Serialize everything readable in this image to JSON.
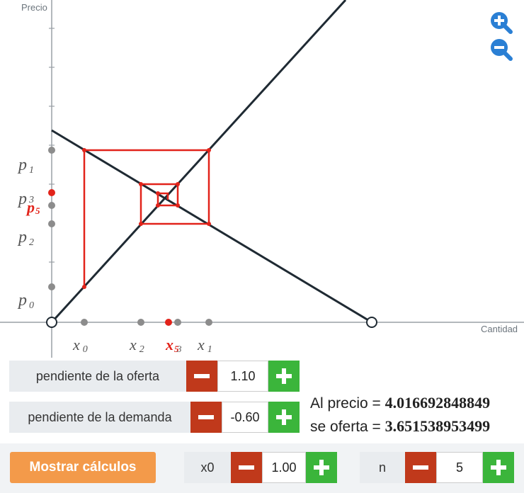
{
  "graph": {
    "y_axis_label": "Precio",
    "x_axis_label": "Cantidad",
    "price_labels": [
      {
        "base": "p",
        "sub": "1"
      },
      {
        "base": "p",
        "sub": "3"
      },
      {
        "base": "p",
        "sub": "5"
      },
      {
        "base": "p",
        "sub": "2"
      },
      {
        "base": "p",
        "sub": "0"
      }
    ],
    "quantity_labels": [
      {
        "base": "x",
        "sub": "0"
      },
      {
        "base": "x",
        "sub": "2"
      },
      {
        "base": "x",
        "sub": "5"
      },
      {
        "base": "x",
        "sub": "3"
      },
      {
        "base": "x",
        "sub": "1"
      }
    ],
    "colors": {
      "curves": "#1f2a33",
      "cobweb": "#e2231a",
      "points": "#8c8c8c",
      "highlight": "#e2231a"
    }
  },
  "controls": {
    "supply_slope": {
      "label": "pendiente de la oferta",
      "value": "1.10"
    },
    "demand_slope": {
      "label": "pendiente de la demanda",
      "value": "-0.60"
    },
    "x0": {
      "label": "x0",
      "value": "1.00"
    },
    "n": {
      "label": "n",
      "value": "5"
    }
  },
  "results": {
    "line1_prefix": "Al precio = ",
    "line1_value": "4.016692848849",
    "line2_prefix": "se oferta = ",
    "line2_value": "3.651538953499"
  },
  "buttons": {
    "show_calculations": "Mostrar cálculos"
  },
  "icons": {
    "zoom_in": "zoom-in-icon",
    "zoom_out": "zoom-out-icon",
    "minus": "minus-icon",
    "plus": "plus-icon"
  }
}
